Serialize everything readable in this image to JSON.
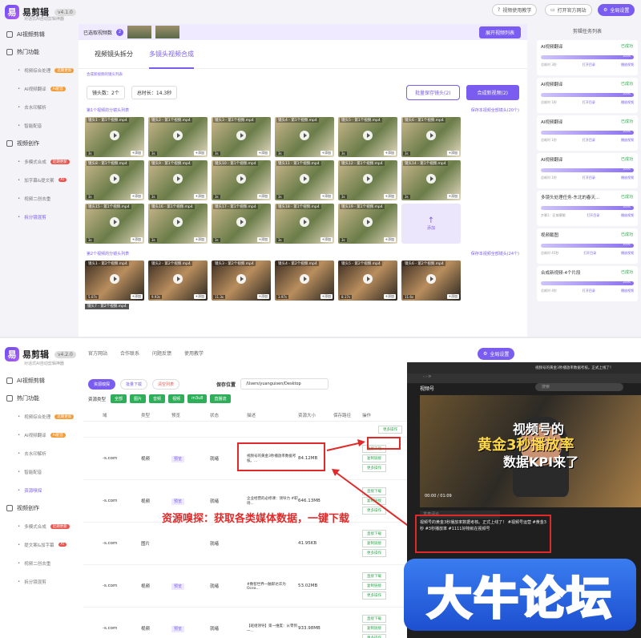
{
  "app": {
    "name": "易剪辑",
    "version": "v4.1.0",
    "version2": "v4.2.0",
    "subtitle": "对话式AI自动剪辑神器"
  },
  "top1": {
    "tutorial": "视频使用教学",
    "website": "打开官方网站",
    "settings": "全局设置"
  },
  "top2": {
    "website": "官方网站",
    "cooperate": "合作联系",
    "feedback": "问题反馈",
    "tutorial": "使用教学",
    "settings": "全局设置"
  },
  "sidebar1": [
    {
      "label": "AI视频剪辑",
      "type": "main"
    },
    {
      "label": "热门功能",
      "type": "main"
    },
    {
      "label": "视频综合处理",
      "type": "sub",
      "tag": "近期更新"
    },
    {
      "label": "AI视频翻译",
      "type": "sub",
      "tag": "AI配音"
    },
    {
      "label": "去水印解析",
      "type": "sub"
    },
    {
      "label": "智能配音",
      "type": "sub"
    },
    {
      "label": "视频创作",
      "type": "main"
    },
    {
      "label": "多模式合成",
      "type": "sub",
      "tag": "近期更新"
    },
    {
      "label": "加字幕&提文案",
      "type": "sub",
      "tag": "AI"
    },
    {
      "label": "视频二创去重",
      "type": "sub"
    },
    {
      "label": "拆分镜混剪",
      "type": "sub",
      "active": true
    }
  ],
  "sidebar2": [
    {
      "label": "AI视频剪辑",
      "type": "main"
    },
    {
      "label": "热门功能",
      "type": "main"
    },
    {
      "label": "视频综合处理",
      "type": "sub",
      "tag": "近期更新"
    },
    {
      "label": "AI视频翻译",
      "type": "sub",
      "tag": "AI配音"
    },
    {
      "label": "去水印解析",
      "type": "sub"
    },
    {
      "label": "智能配音",
      "type": "sub"
    },
    {
      "label": "资源嗅探",
      "type": "sub",
      "active": true
    },
    {
      "label": "视频创作",
      "type": "main"
    },
    {
      "label": "多模式合成",
      "type": "sub",
      "tag": "近期更新"
    },
    {
      "label": "提文案&加字幕",
      "type": "sub",
      "tag": "AI"
    },
    {
      "label": "视频二创去重",
      "type": "sub"
    },
    {
      "label": "拆分镜混剪",
      "type": "sub"
    }
  ],
  "editor": {
    "selected_label": "已选取视频数",
    "selected_count": "2",
    "expand": "展开视频列表",
    "tabs": [
      "视频镜头拆分",
      "多镜头视频合成"
    ],
    "hint": "合成新视频的镜头列表",
    "shots": "镜头数：2个",
    "duration": "总时长：14.3秒",
    "batch_save": "批量保存镜头(2)",
    "compose": "合成新视频(2)",
    "group1": "第1个视频的分镜头列表",
    "group1_save": "保存本视频全部镜头(20个)",
    "group2": "第2个视频的分镜头列表",
    "group2_save": "保存本视频全部镜头(24个)",
    "add_label": "+添加",
    "add_tile": "添加",
    "clips1": [
      {
        "name": "镜头1 - 第1个视频.mp4",
        "dur": "3s"
      },
      {
        "name": "镜头2 - 第1个视频.mp4",
        "dur": "3s"
      },
      {
        "name": "镜头3 - 第1个视频.mp4",
        "dur": "3s"
      },
      {
        "name": "镜头4 - 第1个视频.mp4",
        "dur": "3s"
      },
      {
        "name": "镜头5 - 第1个视频.mp4",
        "dur": "3s"
      },
      {
        "name": "镜头6 - 第1个视频.mp4",
        "dur": "3s"
      },
      {
        "name": "镜头8 - 第1个视频.mp4",
        "dur": "3s"
      },
      {
        "name": "镜头9 - 第1个视频.mp4",
        "dur": "3s"
      },
      {
        "name": "镜头10 - 第1个视频.mp4",
        "dur": "3s"
      },
      {
        "name": "镜头11 - 第1个视频.mp4",
        "dur": "3s"
      },
      {
        "name": "镜头12 - 第1个视频.mp4",
        "dur": "3s"
      },
      {
        "name": "镜头14 - 第1个视频.mp4",
        "dur": "3s"
      },
      {
        "name": "镜头15 - 第1个视频.mp4",
        "dur": "3s"
      },
      {
        "name": "镜头16 - 第1个视频.mp4",
        "dur": "3s"
      },
      {
        "name": "镜头17 - 第1个视频.mp4",
        "dur": "3s"
      },
      {
        "name": "镜头18 - 第1个视频.mp4",
        "dur": "3s"
      },
      {
        "name": "镜头19 - 第1个视频.mp4",
        "dur": "3s"
      }
    ],
    "clips2": [
      {
        "name": "镜头1 - 第2个视频.mp4",
        "dur": "5.07s"
      },
      {
        "name": "镜头2 - 第2个视频.mp4",
        "dur": "9.93s"
      },
      {
        "name": "镜头3 - 第2个视频.mp4",
        "dur": "11.3s"
      },
      {
        "name": "镜头4 - 第2个视频.mp4",
        "dur": "3.97s"
      },
      {
        "name": "镜头5 - 第2个视频.mp4",
        "dur": "8.17s"
      },
      {
        "name": "镜头6 - 第2个视频.mp4",
        "dur": "11.6s"
      }
    ],
    "clip2_7": "镜头7 - 第2个视频.mp4"
  },
  "tasks": {
    "title": "剪辑任务列表",
    "status": "已成功",
    "progress": "100%",
    "open_folder": "打开目录",
    "play": "播放视频",
    "items": [
      {
        "name": "AI视频翻译",
        "time": "总耗时 3秒"
      },
      {
        "name": "AI视频翻译",
        "time": "总耗时 1秒"
      },
      {
        "name": "AI视频翻译",
        "time": "总耗时 1秒"
      },
      {
        "name": "AI视频翻译",
        "time": "总耗时 1秒"
      },
      {
        "name": "多镜头处理任务-东北的春天...",
        "time": "步骤1：区域模糊"
      },
      {
        "name": "视频截图",
        "time": "总耗时 45秒"
      },
      {
        "name": "合成新视频-4个片段",
        "time": "总耗时 4秒"
      }
    ]
  },
  "sniff": {
    "filters": [
      "资源嗅探",
      "批量下载",
      "清空列表"
    ],
    "save_label": "保存位置",
    "save_path": "/Users/yuanguisen/Desktop",
    "type_label": "资源类型",
    "types": [
      "全部",
      "图片",
      "音频",
      "视频",
      "m3u8",
      "直播流"
    ],
    "headers": [
      "",
      "域",
      "类型",
      "预览",
      "状态",
      "描述",
      "资源大小",
      "保存路径",
      "操作"
    ],
    "rows": [
      {
        "domain": "-s.com",
        "type": "视频",
        "preview": "预览",
        "status": "就绪",
        "desc": "视频号的黄金3秒播放率数据考核。...",
        "size": "84.12MB"
      },
      {
        "domain": "-s.com",
        "type": "视频",
        "preview": "预览",
        "status": "就绪",
        "desc": "企业经营的必修课：领导力 #职场...",
        "size": "646.13MB"
      },
      {
        "domain": "-s.com",
        "type": "图片",
        "preview": "",
        "status": "就绪",
        "desc": "",
        "size": "41.95KB"
      },
      {
        "domain": "-s.com",
        "type": "视频",
        "preview": "预览",
        "status": "就绪",
        "desc": "#数智世界一触即达华为Ocea...",
        "size": "53.02MB"
      },
      {
        "domain": "-s.com",
        "type": "视频",
        "preview": "预览",
        "status": "就绪",
        "desc": "【班组领导】第一维度：从零到一...",
        "size": "933.98MB"
      }
    ],
    "ops": [
      "直接下载",
      "复制链接",
      "更多操作"
    ],
    "first_ops": [
      "更多操作"
    ]
  },
  "annotation": "资源嗅探：获取各类媒体数据，一键下载",
  "browser": {
    "tab": "视频号的黄金3秒播放率数据考核。正式上线了！",
    "site": "视频号",
    "search": "搜索",
    "video_title": [
      "视频号的",
      "黄金3秒播放率",
      "数据KPI来了"
    ],
    "time": "00:00 / 01:09",
    "comment_placeholder": "发表评论",
    "caption": "视频号的黄金3秒播放率数据考核。正式上线了！ #视频号运营 #黄金3秒 #3秒播放率 #1111好物就在视频号"
  },
  "watermark": "大牛论坛"
}
